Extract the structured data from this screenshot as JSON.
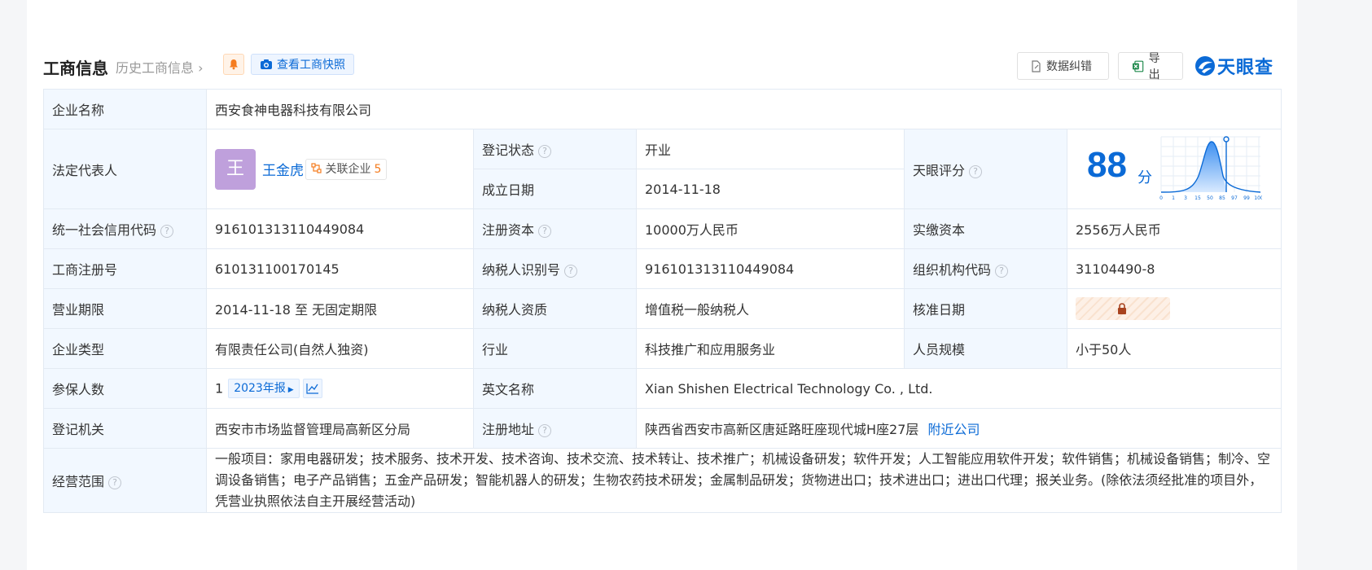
{
  "header": {
    "title": "工商信息",
    "history_link": "历史工商信息",
    "snapshot_button": "查看工商快照",
    "correct_button": "数据纠错",
    "export_button": "导出",
    "logo_text": "天眼查"
  },
  "rows": {
    "company_name_label": "企业名称",
    "company_name": "西安食神电器科技有限公司",
    "legal_rep_label": "法定代表人",
    "avatar_char": "王",
    "legal_rep_name": "王金虎",
    "related_label": "关联企业",
    "related_count": "5",
    "reg_status_label": "登记状态",
    "reg_status": "开业",
    "founded_label": "成立日期",
    "founded": "2014-11-18",
    "score_label": "天眼评分",
    "score": "88",
    "score_unit": "分",
    "score_axis": [
      "0",
      "1",
      "3",
      "15",
      "50",
      "85",
      "97",
      "99",
      "100"
    ],
    "credit_code_label": "统一社会信用代码",
    "credit_code": "916101313110449084",
    "reg_capital_label": "注册资本",
    "reg_capital": "10000万人民币",
    "paid_capital_label": "实缴资本",
    "paid_capital": "2556万人民币",
    "biz_reg_no_label": "工商注册号",
    "biz_reg_no": "610131100170145",
    "taxpayer_id_label": "纳税人识别号",
    "taxpayer_id": "916101313110449084",
    "org_code_label": "组织机构代码",
    "org_code": "31104490-8",
    "biz_term_label": "营业期限",
    "biz_term": "2014-11-18 至 无固定期限",
    "taxpayer_qual_label": "纳税人资质",
    "taxpayer_qual": "增值税一般纳税人",
    "approval_date_label": "核准日期",
    "company_type_label": "企业类型",
    "company_type": "有限责任公司(自然人独资)",
    "industry_label": "行业",
    "industry": "科技推广和应用服务业",
    "staff_size_label": "人员规模",
    "staff_size": "小于50人",
    "insured_label": "参保人数",
    "insured_count": "1",
    "annual_report_tag": "2023年报",
    "english_name_label": "英文名称",
    "english_name": "Xian Shishen Electrical Technology Co. , Ltd.",
    "reg_authority_label": "登记机关",
    "reg_authority": "西安市市场监督管理局高新区分局",
    "reg_address_label": "注册地址",
    "reg_address": "陕西省西安市高新区唐延路旺座现代城H座27层",
    "nearby_link": "附近公司",
    "biz_scope_label": "经营范围",
    "biz_scope": "一般项目：家用电器研发；技术服务、技术开发、技术咨询、技术交流、技术转让、技术推广；机械设备研发；软件开发；人工智能应用软件开发；软件销售；机械设备销售；制冷、空调设备销售；电子产品销售；五金产品研发；智能机器人的研发；生物农药技术研发；金属制品研发；货物进出口；技术进出口；进出口代理；报关业务。(除依法须经批准的项目外，凭营业执照依法自主开展经营活动)"
  },
  "colors": {
    "accent": "#0b6ad6",
    "label_bg": "#f2f8ff",
    "status_green": "#19a35a",
    "count_orange": "#f57c1f"
  }
}
